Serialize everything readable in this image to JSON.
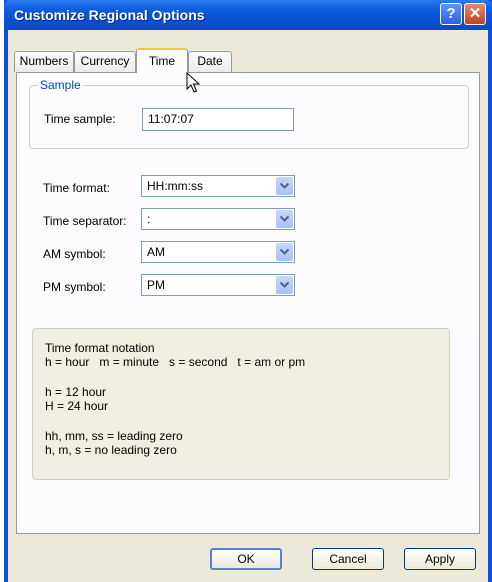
{
  "window": {
    "title": "Customize Regional Options"
  },
  "tabs": [
    {
      "label": "Numbers"
    },
    {
      "label": "Currency"
    },
    {
      "label": "Time"
    },
    {
      "label": "Date"
    }
  ],
  "active_tab": "Time",
  "sample": {
    "group_label": "Sample",
    "time_sample_label": "Time sample:",
    "time_sample_value": "11:07:07"
  },
  "fields": {
    "time_format": {
      "label": "Time format:",
      "value": "HH:mm:ss"
    },
    "time_separator": {
      "label": "Time separator:",
      "value": ":"
    },
    "am_symbol": {
      "label": "AM symbol:",
      "value": "AM"
    },
    "pm_symbol": {
      "label": "PM symbol:",
      "value": "PM"
    }
  },
  "notation": {
    "title": "Time format notation",
    "line1": "h = hour   m = minute   s = second   t = am or pm",
    "line2": "h = 12 hour",
    "line3": "H = 24 hour",
    "line4": "hh, mm, ss = leading zero",
    "line5": "h, m, s = no leading zero"
  },
  "buttons": {
    "ok": "OK",
    "cancel": "Cancel",
    "apply": "Apply"
  },
  "titlebar_buttons": {
    "help": "?",
    "close": "✕"
  },
  "colors": {
    "titlebar": "#0a52d6",
    "dialog_bg": "#ece9d8",
    "group_label": "#0046d5",
    "active_tab_highlight": "#ffc83c"
  },
  "icons": [
    "help-icon",
    "close-icon",
    "chevron-down-icon",
    "mouse-pointer-icon"
  ]
}
